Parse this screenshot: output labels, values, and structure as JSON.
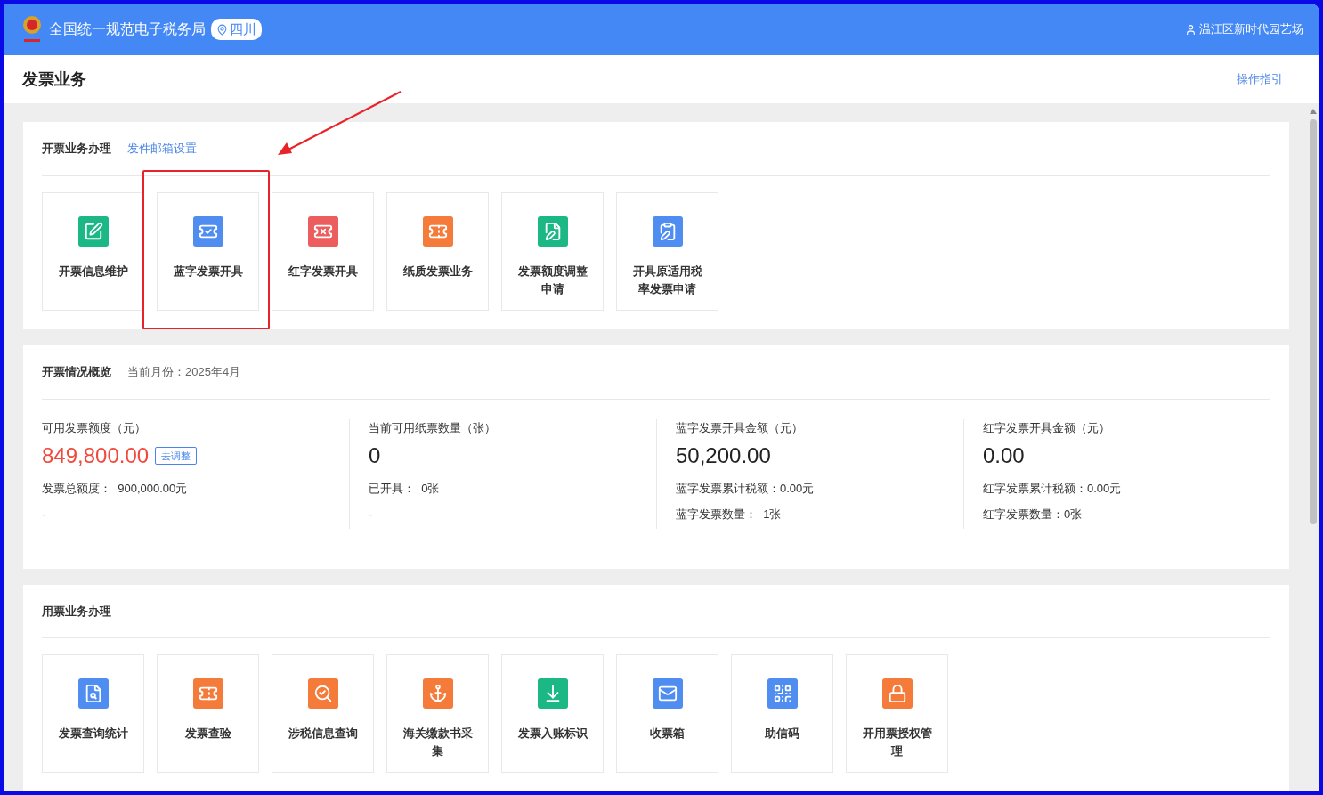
{
  "header": {
    "title": "全国统一规范电子税务局",
    "region": "四川",
    "user": "温江区新时代园艺场"
  },
  "page": {
    "title": "发票业务",
    "guide_link": "操作指引"
  },
  "issue_section": {
    "title": "开票业务办理",
    "link": "发件邮箱设置",
    "tiles": [
      {
        "label": "开票信息维护",
        "color": "#1bb785",
        "highlighted": false
      },
      {
        "label": "蓝字发票开具",
        "color": "#4f8ef0",
        "highlighted": true
      },
      {
        "label": "红字发票开具",
        "color": "#ec5d5d",
        "highlighted": false
      },
      {
        "label": "纸质发票业务",
        "color": "#f47b3a",
        "highlighted": false
      },
      {
        "label": "发票额度调整申请",
        "color": "#1bb785",
        "highlighted": false
      },
      {
        "label": "开具原适用税率发票申请",
        "color": "#4f8ef0",
        "highlighted": false
      }
    ]
  },
  "overview": {
    "title": "开票情况概览",
    "month": "当前月份：2025年4月",
    "stats": [
      {
        "label": "可用发票额度（元）",
        "value": "849,800.00",
        "alert": true,
        "button": "去调整",
        "lines": [
          "发票总额度：  900,000.00元",
          "-"
        ]
      },
      {
        "label": "当前可用纸票数量（张）",
        "value": "0",
        "alert": false,
        "lines": [
          "已开具：  0张",
          "-"
        ]
      },
      {
        "label": "蓝字发票开具金额（元）",
        "value": "50,200.00",
        "alert": false,
        "lines": [
          "蓝字发票累计税额：0.00元",
          "蓝字发票数量：  1张"
        ]
      },
      {
        "label": "红字发票开具金额（元）",
        "value": "0.00",
        "alert": false,
        "lines": [
          "红字发票累计税额：0.00元",
          "红字发票数量：0张"
        ]
      }
    ]
  },
  "use_section": {
    "title": "用票业务办理",
    "tiles": [
      {
        "label": "发票查询统计",
        "color": "#4f8ef0",
        "highlighted": false
      },
      {
        "label": "发票查验",
        "color": "#f47b3a",
        "highlighted": false
      },
      {
        "label": "涉税信息查询",
        "color": "#f47b3a",
        "highlighted": false
      },
      {
        "label": "海关缴款书采集",
        "color": "#f47b3a",
        "highlighted": false
      },
      {
        "label": "发票入账标识",
        "color": "#1bb785",
        "highlighted": false
      },
      {
        "label": "收票箱",
        "color": "#4f8ef0",
        "highlighted": false
      },
      {
        "label": "助信码",
        "color": "#4f8ef0",
        "highlighted": false
      },
      {
        "label": "开用票授权管理",
        "color": "#f47b3a",
        "highlighted": false
      }
    ]
  }
}
